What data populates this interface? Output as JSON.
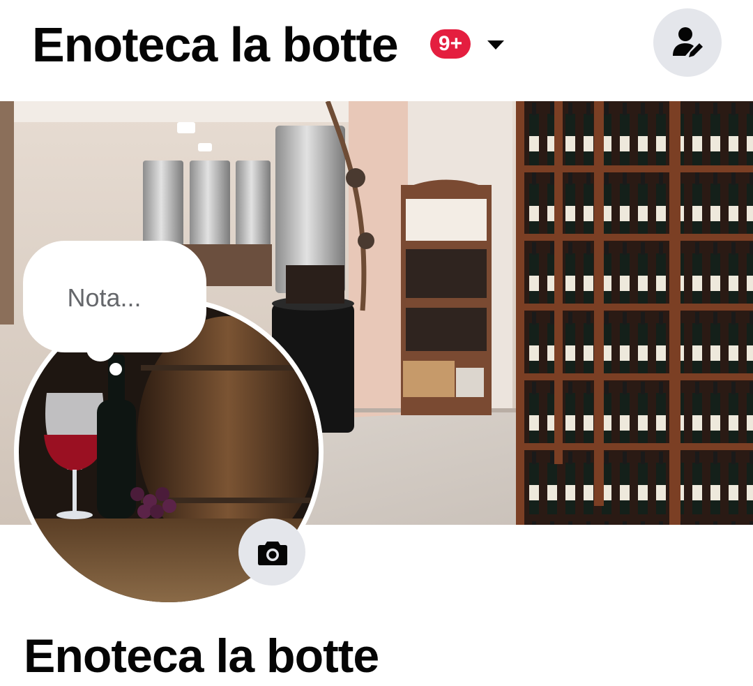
{
  "header": {
    "page_name": "Enoteca la botte",
    "notification_badge": "9+",
    "dropdown_icon": "caret-down-icon",
    "profile_switch_icon": "person-edit-icon"
  },
  "cover": {
    "image": "wine-shop-interior",
    "camera_icon": "camera-icon"
  },
  "profile": {
    "image": "wine-glass-bottle-barrel",
    "camera_icon": "camera-icon",
    "note_placeholder": "Nota...",
    "name": "Enoteca la botte"
  },
  "colors": {
    "badge": "#e41e3f",
    "icon_bg": "#e4e6eb",
    "text": "#050505",
    "note_text": "#65676b"
  }
}
